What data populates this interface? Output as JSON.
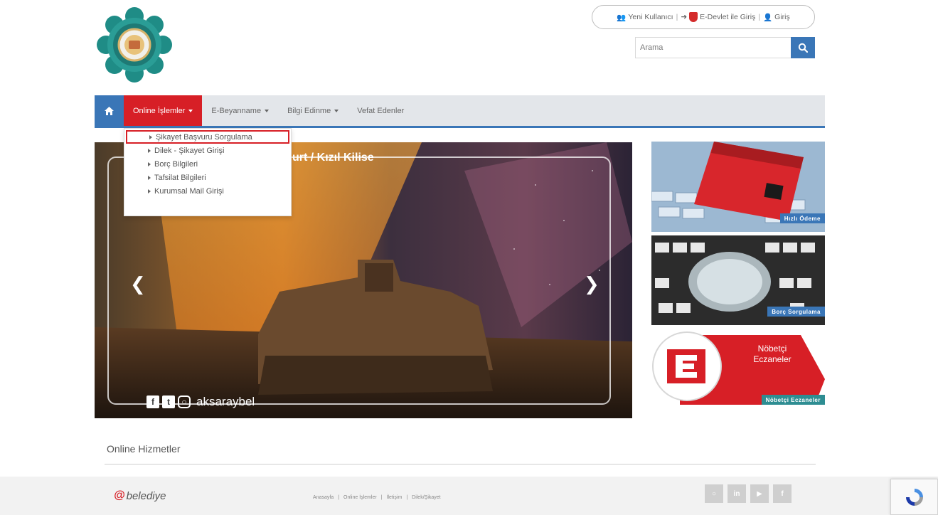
{
  "header": {
    "top_links": {
      "new_user": "Yeni Kullanıcı",
      "edevlet": "E-Devlet ile Giriş",
      "login": "Giriş"
    },
    "search": {
      "placeholder": "Arama"
    }
  },
  "nav": {
    "items": [
      {
        "label": "Online İşlemler"
      },
      {
        "label": "E-Beyanname"
      },
      {
        "label": "Bilgi Edinme"
      },
      {
        "label": "Vefat Edenler"
      }
    ],
    "dropdown": [
      {
        "label": "Şikayet Başvuru Sorgulama"
      },
      {
        "label": "Dilek - Şikayet Girişi"
      },
      {
        "label": "Borç Bilgileri"
      },
      {
        "label": "Tafsilat Bilgileri"
      },
      {
        "label": "Kurumsal Mail Girişi"
      }
    ]
  },
  "slider": {
    "title": "urt / Kızıl Kilise",
    "handle": "aksaraybel"
  },
  "side_cards": {
    "payment_label": "Hızlı Ödeme",
    "debt_label": "Borç Sorgulama",
    "pharmacy_title": "Nöbetçi Eczaneler",
    "pharmacy_label": "Nöbetçi Eczaneler"
  },
  "section": {
    "title": "Online Hizmetler"
  },
  "footer": {
    "brand": "belediye",
    "links": [
      "Anasayfa",
      "Online İşlemler",
      "İletişim",
      "Dilek/Şikayet"
    ]
  },
  "colors": {
    "brand_red": "#d71f26",
    "brand_blue": "#3a76b7",
    "nav_bg": "#e3e6ea",
    "teal": "#1f8c86"
  }
}
